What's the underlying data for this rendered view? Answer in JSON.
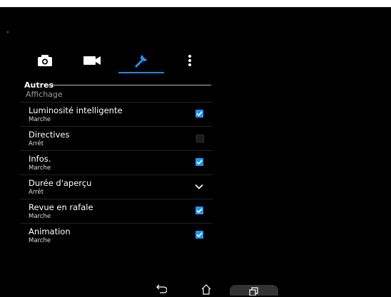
{
  "tabs": [
    {
      "id": "camera",
      "icon": "camera-icon"
    },
    {
      "id": "video",
      "icon": "video-camera-icon"
    },
    {
      "id": "settings",
      "icon": "wrench-icon",
      "selected": true
    },
    {
      "id": "more",
      "icon": "more-vert-icon"
    }
  ],
  "section": {
    "label": "Autres"
  },
  "category": {
    "label": "Affichage"
  },
  "items": [
    {
      "title": "Luminosité intelligente",
      "status": "Marche",
      "control": "checkbox",
      "checked": true
    },
    {
      "title": "Directives",
      "status": "Arrêt",
      "control": "checkbox",
      "checked": false
    },
    {
      "title": "Infos.",
      "status": "Marche",
      "control": "checkbox",
      "checked": true
    },
    {
      "title": "Durée d'aperçu",
      "status": "Arrêt",
      "control": "dropdown"
    },
    {
      "title": "Revue en rafale",
      "status": "Marche",
      "control": "checkbox",
      "checked": true
    },
    {
      "title": "Animation",
      "status": "Marche",
      "control": "checkbox",
      "checked": true
    }
  ],
  "colors": {
    "accent": "#2196f3",
    "tab_underline": "#1e88e5",
    "background": "#000000"
  },
  "nav": [
    {
      "id": "back",
      "icon": "back-icon"
    },
    {
      "id": "home",
      "icon": "home-icon"
    },
    {
      "id": "recents",
      "icon": "recents-icon"
    }
  ]
}
